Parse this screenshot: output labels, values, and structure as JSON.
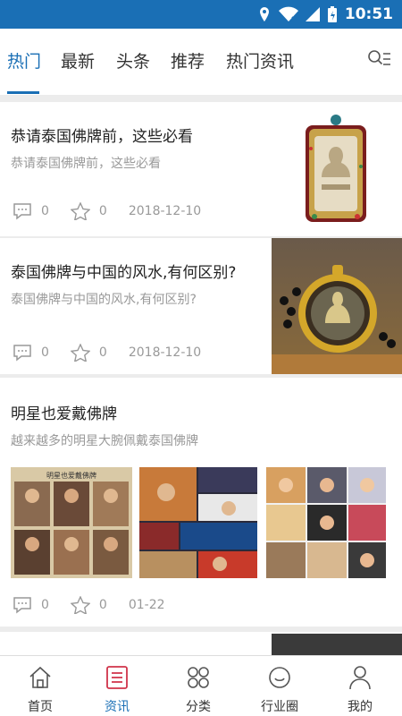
{
  "status_bar": {
    "time": "10:51"
  },
  "tabs": [
    {
      "label": "热门",
      "active": true
    },
    {
      "label": "最新",
      "active": false
    },
    {
      "label": "头条",
      "active": false
    },
    {
      "label": "推荐",
      "active": false
    },
    {
      "label": "热门资讯",
      "active": false
    }
  ],
  "articles": [
    {
      "title": "恭请泰国佛牌前，这些必看",
      "summary": "恭请泰国佛牌前，这些必看",
      "comments": "0",
      "stars": "0",
      "date": "2018-12-10"
    },
    {
      "title": "泰国佛牌与中国的风水,有何区别?",
      "summary": "泰国佛牌与中国的风水,有何区别?",
      "comments": "0",
      "stars": "0",
      "date": "2018-12-10"
    },
    {
      "title": "明星也爱戴佛牌",
      "summary": "越来越多的明星大腕佩戴泰国佛牌",
      "comments": "0",
      "stars": "0",
      "date": "01-22",
      "image_caption": "明星也爱戴佛牌"
    }
  ],
  "bottom_nav": [
    {
      "label": "首页",
      "icon": "home-icon",
      "active": false
    },
    {
      "label": "资讯",
      "icon": "news-icon",
      "active": true
    },
    {
      "label": "分类",
      "icon": "category-icon",
      "active": false
    },
    {
      "label": "行业圈",
      "icon": "circle-icon",
      "active": false
    },
    {
      "label": "我的",
      "icon": "profile-icon",
      "active": false
    }
  ],
  "colors": {
    "accent": "#1a6fb5",
    "text": "#222222",
    "muted": "#999999"
  }
}
